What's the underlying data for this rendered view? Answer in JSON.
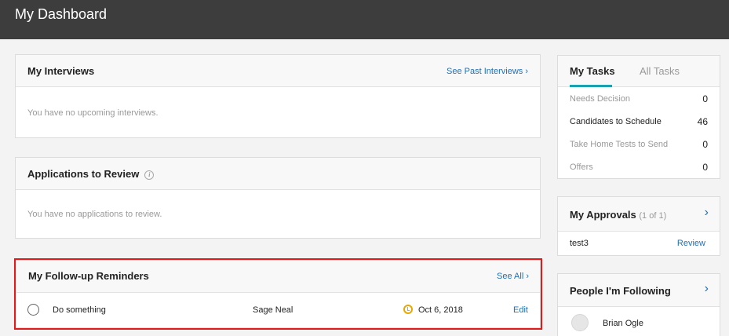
{
  "header": {
    "title": "My Dashboard"
  },
  "interviews": {
    "title": "My Interviews",
    "link": "See Past Interviews",
    "empty": "You have no upcoming interviews."
  },
  "applications": {
    "title": "Applications to Review",
    "empty": "You have no applications to review."
  },
  "reminders": {
    "title": "My Follow-up Reminders",
    "link": "See All",
    "items": [
      {
        "task": "Do something",
        "person": "Sage Neal",
        "date": "Oct 6, 2018",
        "action": "Edit"
      }
    ]
  },
  "tasks": {
    "tabs": [
      "My Tasks",
      "All Tasks"
    ],
    "rows": [
      {
        "label": "Needs Decision",
        "count": "0"
      },
      {
        "label": "Candidates to Schedule",
        "count": "46"
      },
      {
        "label": "Take Home Tests to Send",
        "count": "0"
      },
      {
        "label": "Offers",
        "count": "0"
      }
    ]
  },
  "approvals": {
    "title": "My Approvals",
    "count": "(1 of 1)",
    "item": "test3",
    "action": "Review"
  },
  "following": {
    "title": "People I'm Following",
    "person": "Brian Ogle"
  },
  "colors": {
    "accent": "#1aa1b0",
    "link": "#1f6fb5",
    "highlight": "#e01b1b",
    "alarm": "#e8a800"
  }
}
